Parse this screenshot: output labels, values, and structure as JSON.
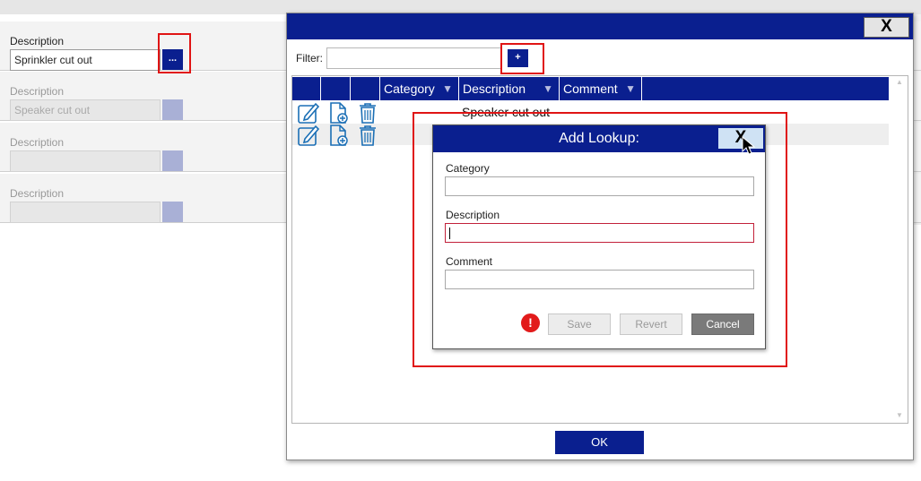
{
  "form": {
    "rows": [
      {
        "label": "Description",
        "value": "Sprinkler cut out",
        "button": "..."
      },
      {
        "label": "Description",
        "value": "Speaker cut out",
        "button": ""
      },
      {
        "label": "Description",
        "value": "",
        "button": ""
      },
      {
        "label": "Description",
        "value": "",
        "button": ""
      }
    ]
  },
  "dialog": {
    "close_label": "X",
    "filter_label": "Filter:",
    "add_label": "+",
    "columns": [
      "",
      "",
      "",
      "Category",
      "Description",
      "Comment"
    ],
    "rows": [
      {
        "category": "",
        "description": "Speaker cut out",
        "comment": ""
      },
      {
        "category": "",
        "description": "",
        "comment": ""
      }
    ],
    "ok_label": "OK"
  },
  "popup": {
    "title": "Add Lookup:",
    "close_label": "X",
    "fields": {
      "category_label": "Category",
      "description_label": "Description",
      "comment_label": "Comment"
    },
    "buttons": {
      "save": "Save",
      "revert": "Revert",
      "cancel": "Cancel"
    },
    "error_icon": "!"
  },
  "colors": {
    "accent": "#0a1f8f",
    "highlight": "#e01414"
  }
}
